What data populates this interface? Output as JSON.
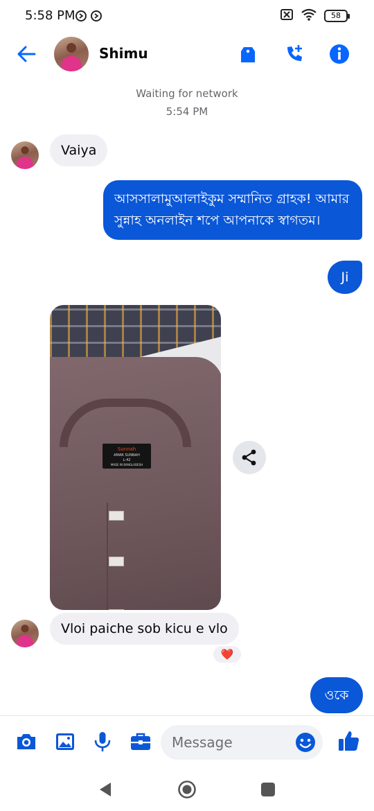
{
  "status_bar": {
    "time": "5:58 PM",
    "battery": "58",
    "icons": [
      "whatsapp-icon",
      "whatsapp-icon",
      "no-sim-icon",
      "wifi-icon",
      "battery-icon"
    ]
  },
  "header": {
    "back_icon": "arrow-left-icon",
    "contact_name": "Shimu",
    "actions": [
      "tag-icon",
      "call-add-icon",
      "info-icon"
    ]
  },
  "chat": {
    "network_status": "Waiting for network",
    "timestamp": "5:54 PM",
    "messages": [
      {
        "direction": "incoming",
        "text": "Vaiya"
      },
      {
        "direction": "outgoing",
        "text": "আসসালামুআলাইকুম সম্মানিত গ্রাহক! আমার সুন্নাহ অনলাইন শপে আপনাকে স্বাগতম।"
      },
      {
        "direction": "outgoing",
        "text": "Ji"
      },
      {
        "direction": "incoming",
        "type": "photo"
      },
      {
        "direction": "incoming",
        "text": "Vloi paiche sob kicu e vlo",
        "reaction": "❤️"
      },
      {
        "direction": "outgoing",
        "text": "ওকে"
      }
    ],
    "photo": {
      "label_brand": "Sunnah",
      "label_line2": "AMAR SUNNAH",
      "label_size": "L-42",
      "label_line4": "MADE IN BANGLADESH"
    }
  },
  "composer": {
    "placeholder": "Message",
    "icons": [
      "camera-icon",
      "image-icon",
      "mic-icon",
      "briefcase-icon",
      "emoji-icon",
      "like-icon"
    ]
  },
  "colors": {
    "accent": "#0a57d8",
    "header_icon": "#0866ff",
    "incoming_bubble": "#f0f0f4"
  }
}
